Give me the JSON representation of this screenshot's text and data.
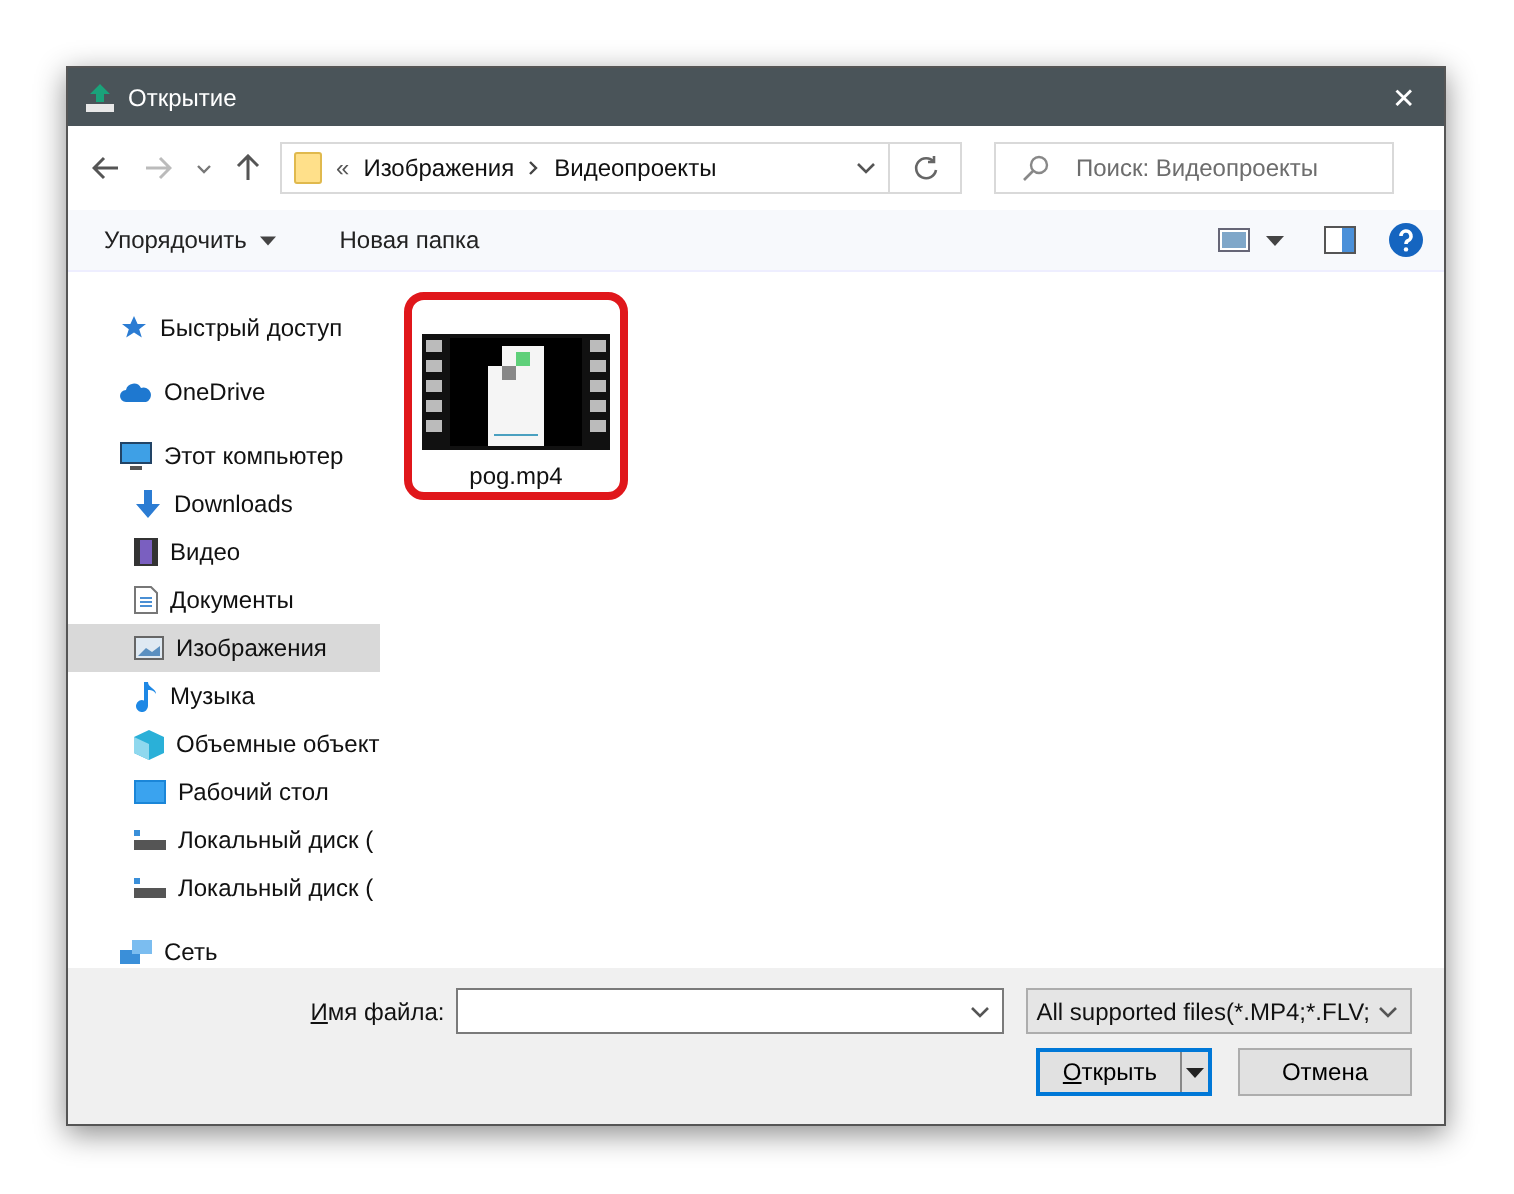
{
  "window": {
    "title": "Открытие",
    "close": "✕"
  },
  "breadcrumb": {
    "overflow": "«",
    "parts": [
      "Изображения",
      "Видеопроекты"
    ]
  },
  "search": {
    "placeholder": "Поиск: Видеопроекты"
  },
  "toolbar": {
    "organize": "Упорядочить",
    "new_folder": "Новая папка"
  },
  "sidebar": {
    "items": [
      {
        "label": "Быстрый доступ",
        "selected": false
      },
      {
        "label": "OneDrive",
        "selected": false
      },
      {
        "label": "Этот компьютер",
        "selected": false,
        "children": [
          {
            "label": "Downloads",
            "selected": false
          },
          {
            "label": "Видео",
            "selected": false
          },
          {
            "label": "Документы",
            "selected": false
          },
          {
            "label": "Изображения",
            "selected": true
          },
          {
            "label": "Музыка",
            "selected": false
          },
          {
            "label": "Объемные объект",
            "selected": false
          },
          {
            "label": "Рабочий стол",
            "selected": false
          },
          {
            "label": "Локальный диск (",
            "selected": false
          },
          {
            "label": "Локальный диск (",
            "selected": false
          }
        ]
      },
      {
        "label": "Сеть",
        "selected": false
      }
    ]
  },
  "files": [
    {
      "name": "pog.mp4",
      "highlighted": true
    }
  ],
  "footer": {
    "filename_label": "Имя файла:",
    "filter": "All supported files(*.MP4;*.FLV;",
    "open": "Открыть",
    "cancel": "Отмена"
  }
}
